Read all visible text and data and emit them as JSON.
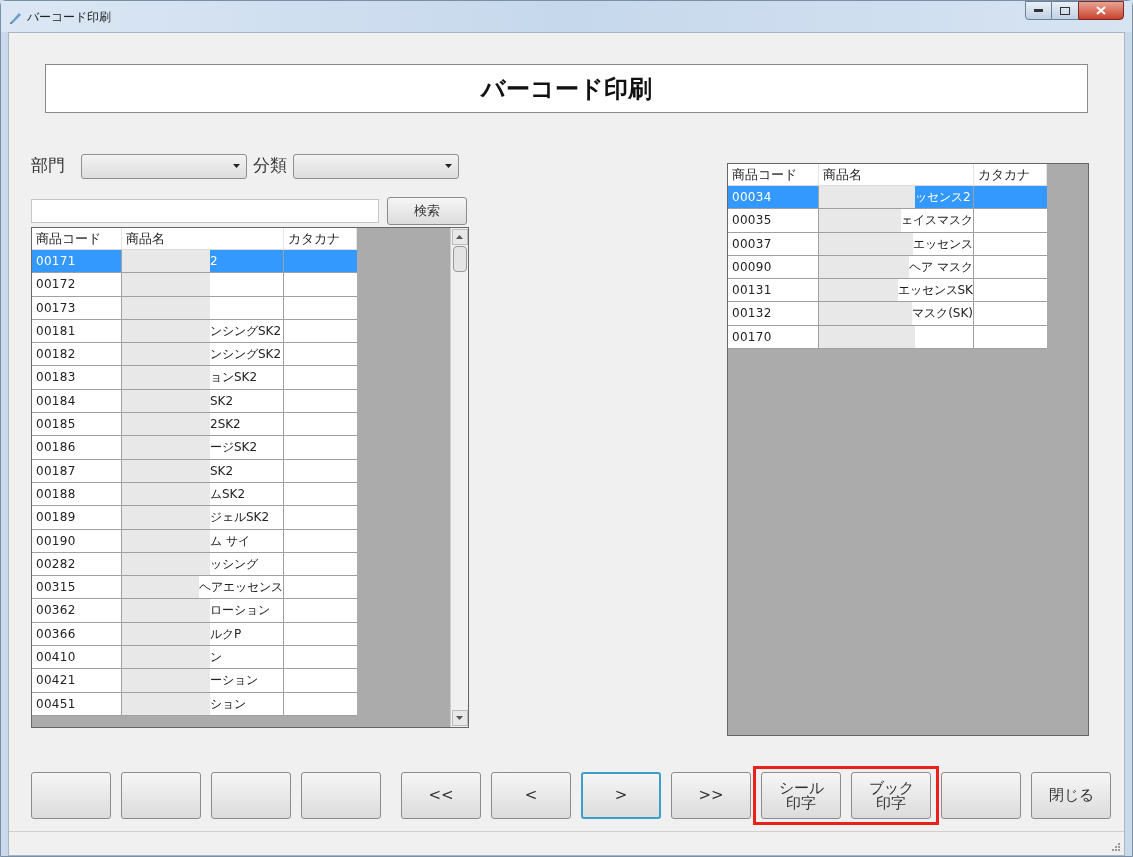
{
  "window": {
    "title": "バーコード印刷"
  },
  "header": {
    "title": "バーコード印刷"
  },
  "filters": [
    {
      "label": "部門"
    },
    {
      "label": "分類"
    }
  ],
  "search": {
    "button": "検索"
  },
  "left_table": {
    "columns": [
      "商品コード",
      "商品名",
      "カタカナ"
    ],
    "rows": [
      {
        "code": "00171",
        "name": "2",
        "selected": true
      },
      {
        "code": "00172",
        "selected": false
      },
      {
        "code": "00173",
        "selected": false
      },
      {
        "code": "00181",
        "name": "ンシングSK2",
        "selected": false
      },
      {
        "code": "00182",
        "name": "ンシングSK2",
        "selected": false
      },
      {
        "code": "00183",
        "name": "ョンSK2",
        "selected": false
      },
      {
        "code": "00184",
        "name": "SK2",
        "selected": false
      },
      {
        "code": "00185",
        "name": "2SK2",
        "selected": false
      },
      {
        "code": "00186",
        "name": "ージSK2",
        "selected": false
      },
      {
        "code": "00187",
        "name": "SK2",
        "selected": false
      },
      {
        "code": "00188",
        "name": "ムSK2",
        "selected": false
      },
      {
        "code": "00189",
        "name": "ジェルSK2",
        "selected": false
      },
      {
        "code": "00190",
        "name": "ム サイ",
        "selected": false
      },
      {
        "code": "00282",
        "name": "ッシング",
        "selected": false
      },
      {
        "code": "00315",
        "name": "ヘアエッセンス",
        "selected": false
      },
      {
        "code": "00362",
        "name": "ローション",
        "selected": false
      },
      {
        "code": "00366",
        "name": "ルクP",
        "selected": false
      },
      {
        "code": "00410",
        "name": "ン",
        "selected": false
      },
      {
        "code": "00421",
        "name": "ーション",
        "selected": false
      },
      {
        "code": "00451",
        "name": "ション",
        "selected": false
      }
    ]
  },
  "right_table": {
    "columns": [
      "商品コード",
      "商品名",
      "カタカナ"
    ],
    "rows": [
      {
        "code": "00034",
        "name": "ッセンス2",
        "selected": true
      },
      {
        "code": "00035",
        "name": "ェイスマスク",
        "selected": false
      },
      {
        "code": "00037",
        "name": "エッセンス",
        "selected": false
      },
      {
        "code": "00090",
        "name": "ヘア マスク",
        "selected": false
      },
      {
        "code": "00131",
        "name": "エッセンスSK",
        "selected": false
      },
      {
        "code": "00132",
        "name": "マスク(SK)",
        "selected": false
      },
      {
        "code": "00170",
        "selected": false
      }
    ]
  },
  "button_groups": [
    {
      "kind": "plain",
      "buttons": [
        {
          "focused": false
        },
        {
          "focused": false
        },
        {
          "focused": false
        },
        {
          "focused": false
        }
      ]
    },
    {
      "kind": "plain",
      "buttons": [
        {
          "label": "<<",
          "focused": false
        },
        {
          "label": "<",
          "focused": false
        },
        {
          "label": ">",
          "focused": true
        },
        {
          "label": ">>",
          "focused": false
        }
      ]
    },
    {
      "kind": "highlighted",
      "buttons": [
        {
          "label": "シール印字",
          "focused": false
        },
        {
          "label": "ブック印字",
          "focused": false
        }
      ]
    },
    {
      "kind": "plain",
      "buttons": [
        {
          "focused": false
        },
        {
          "label": "閉じる",
          "focused": false
        }
      ]
    }
  ]
}
